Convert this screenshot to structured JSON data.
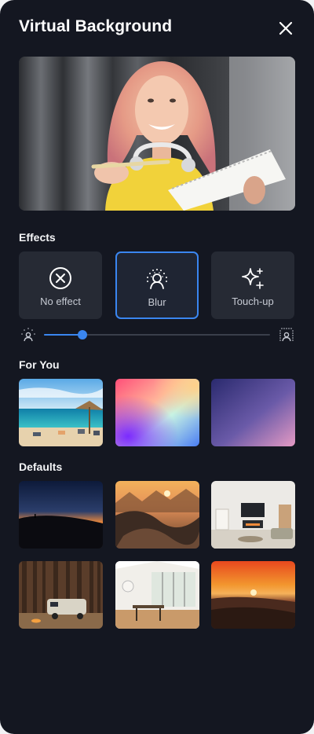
{
  "dialog": {
    "title": "Virtual Background",
    "close_icon": "close-icon"
  },
  "effects": {
    "heading": "Effects",
    "items": [
      {
        "label": "No effect",
        "icon": "no-effect-icon",
        "selected": false
      },
      {
        "label": "Blur",
        "icon": "blur-icon",
        "selected": true
      },
      {
        "label": "Touch-up",
        "icon": "sparkles-icon",
        "selected": false
      }
    ],
    "blur_level": 0.17,
    "accent": "#3a86f0"
  },
  "for_you": {
    "heading": "For You",
    "items": [
      {
        "name": "beach-background"
      },
      {
        "name": "pastel-gradient-background"
      },
      {
        "name": "purple-gradient-background"
      }
    ]
  },
  "defaults": {
    "heading": "Defaults",
    "items": [
      {
        "name": "night-hill-background"
      },
      {
        "name": "mountain-sunset-background"
      },
      {
        "name": "living-room-background"
      },
      {
        "name": "forest-camper-background"
      },
      {
        "name": "dining-room-background"
      },
      {
        "name": "desert-sunset-background"
      }
    ]
  }
}
